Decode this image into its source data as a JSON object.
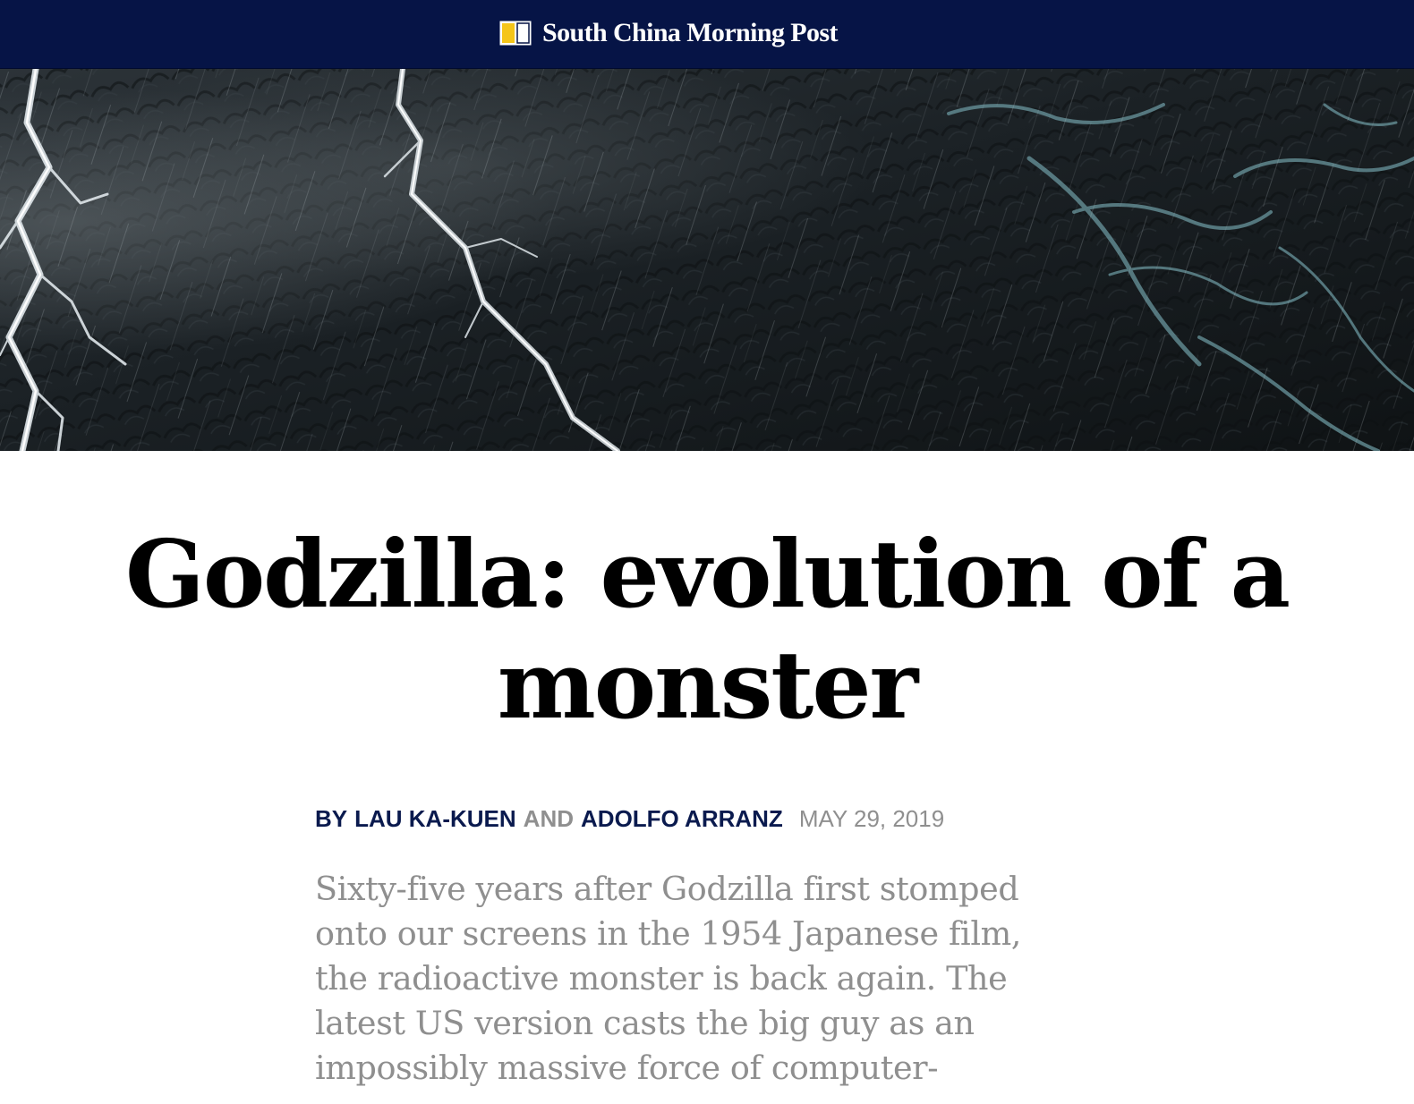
{
  "masthead": {
    "brand_name": "South China Morning Post",
    "background": "#061446",
    "logo_icon": "scmp-logo-icon"
  },
  "article": {
    "title": "Godzilla: evolution of a monster",
    "byline": {
      "prefix": "BY",
      "author_1": "LAU KA-KUEN",
      "connector": "AND",
      "author_2": "ADOLFO ARRANZ",
      "date": "MAY 29, 2019"
    },
    "lede": "Sixty-five years after Godzilla first stomped onto our screens in the 1954 Japanese film, the radioactive monster is back again. The latest US version casts the big guy as an impossibly massive force of computer-"
  },
  "colors": {
    "byline_author": "#0a1a4e",
    "muted_gray": "#8f8f8f"
  }
}
